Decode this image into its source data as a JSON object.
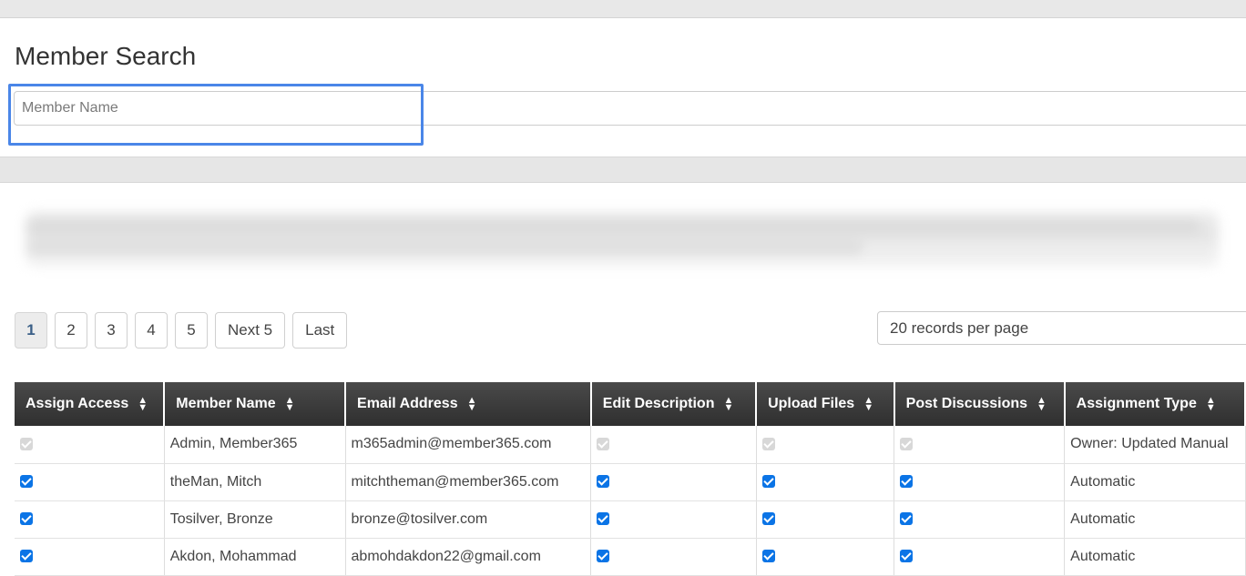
{
  "page": {
    "title": "Member Search"
  },
  "search": {
    "placeholder": "Member Name",
    "value": ""
  },
  "pagination": {
    "pages": [
      "1",
      "2",
      "3",
      "4",
      "5"
    ],
    "current": "1",
    "next_label": "Next 5",
    "last_label": "Last"
  },
  "records_per_page": {
    "selected": "20 records per page"
  },
  "table": {
    "columns": [
      "Assign Access",
      "Member Name",
      "Email Address",
      "Edit Description",
      "Upload Files",
      "Post Discussions",
      "Assignment Type"
    ],
    "rows": [
      {
        "assign": "disabled",
        "name": "Admin, Member365",
        "email": "m365admin@member365.com",
        "edit": "disabled",
        "upload": "disabled",
        "post": "disabled",
        "type": "Owner: Updated Manual"
      },
      {
        "assign": "checked",
        "name": "theMan, Mitch",
        "email": "mitchtheman@member365.com",
        "edit": "checked",
        "upload": "checked",
        "post": "checked",
        "type": "Automatic"
      },
      {
        "assign": "checked",
        "name": "Tosilver, Bronze",
        "email": "bronze@tosilver.com",
        "edit": "checked",
        "upload": "checked",
        "post": "checked",
        "type": "Automatic"
      },
      {
        "assign": "checked",
        "name": "Akdon, Mohammad",
        "email": "abmohdakdon22@gmail.com",
        "edit": "checked",
        "upload": "checked",
        "post": "checked",
        "type": "Automatic"
      }
    ]
  },
  "colors": {
    "focus_outline": "#4a86e8",
    "checkbox": "#0b74e6",
    "header_bg": "#3a3a3a"
  }
}
